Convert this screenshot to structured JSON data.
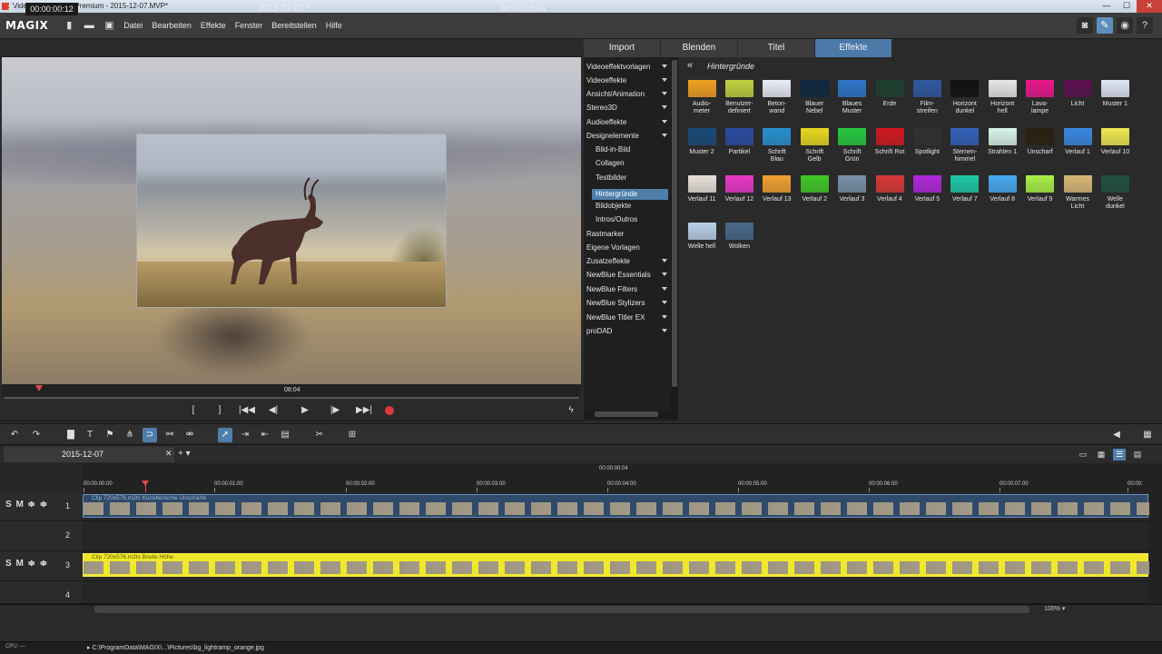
{
  "window": {
    "title": "Video deluxe 2016 Premium - 2015-12-07.MVP*",
    "controls": [
      "—",
      "☐",
      "✕"
    ]
  },
  "menubar": {
    "logo": "MAGIX",
    "items": [
      "Datei",
      "Bearbeiten",
      "Effekte",
      "Fenster",
      "Bereitstellen",
      "Hilfe"
    ]
  },
  "preview": {
    "timecode_left": "00:00:00:12",
    "project_title": "2015-12-07 *",
    "timecode_right": "00:00:08:04",
    "scrub_time": "08:04",
    "transport": [
      "[",
      "]",
      "|◀◀",
      "◀|",
      "▶",
      "|▶",
      "▶▶|"
    ]
  },
  "tabs": [
    {
      "label": "Import",
      "active": false
    },
    {
      "label": "Blenden",
      "active": false
    },
    {
      "label": "Titel",
      "active": false
    },
    {
      "label": "Effekte",
      "active": true
    }
  ],
  "categories": [
    {
      "label": "Videoeffektvorlagen",
      "sub": false,
      "caret": true
    },
    {
      "label": "Videoeffekte",
      "sub": false,
      "caret": true
    },
    {
      "label": "Ansicht/Animation",
      "sub": false,
      "caret": true
    },
    {
      "label": "Stereo3D",
      "sub": false,
      "caret": true
    },
    {
      "label": "Audioeffekte",
      "sub": false,
      "caret": true
    },
    {
      "label": "Designelemente",
      "sub": false,
      "caret": true
    },
    {
      "label": "Bild-in-Bild",
      "sub": true,
      "caret": false
    },
    {
      "label": "Collagen",
      "sub": true,
      "caret": false
    },
    {
      "label": "Testbilder",
      "sub": true,
      "caret": false
    },
    {
      "label": "Hintergründe",
      "sub": true,
      "caret": false,
      "selected": true
    },
    {
      "label": "Bildobjekte",
      "sub": true,
      "caret": false
    },
    {
      "label": "Intros/Outros",
      "sub": true,
      "caret": false
    },
    {
      "label": "Rastmarker",
      "sub": false,
      "caret": false
    },
    {
      "label": "Eigene Vorlagen",
      "sub": false,
      "caret": false
    },
    {
      "label": "Zusatzeffekte",
      "sub": false,
      "caret": true
    },
    {
      "label": "NewBlue Essentials",
      "sub": false,
      "caret": true
    },
    {
      "label": "NewBlue Filters",
      "sub": false,
      "caret": true
    },
    {
      "label": "NewBlue Stylizers",
      "sub": false,
      "caret": true
    },
    {
      "label": "NewBlue Titler EX",
      "sub": false,
      "caret": true
    },
    {
      "label": "proDAD",
      "sub": false,
      "caret": true
    }
  ],
  "grid": {
    "back_icon": "«",
    "title": "Hintergründe",
    "items": [
      {
        "label": "Audio-\nmeter",
        "color": "#f0a020"
      },
      {
        "label": "Benutzer-\ndefiniert",
        "color": "#c0d040"
      },
      {
        "label": "Beton-\nwand",
        "color": "#e8ecf4"
      },
      {
        "label": "Blauer\nNebel",
        "color": "#0f2840"
      },
      {
        "label": "Blaues\nMuster",
        "color": "#2e74c8"
      },
      {
        "label": "Erde",
        "color": "#1e4030"
      },
      {
        "label": "Film-\nstreifen",
        "color": "#3058a0"
      },
      {
        "label": "Horizont\ndunkel",
        "color": "#101010"
      },
      {
        "label": "Horizont\nhell",
        "color": "#e6e6e6"
      },
      {
        "label": "Lava-\nlampe",
        "color": "#e8188c"
      },
      {
        "label": "Licht",
        "color": "#5a1050"
      },
      {
        "label": "Muster 1",
        "color": "#dfe6f4"
      },
      {
        "label": "Muster 2",
        "color": "#1a4a78"
      },
      {
        "label": "Partikel",
        "color": "#2a4aa0"
      },
      {
        "label": "Schrift\nBlau",
        "color": "#2890d0"
      },
      {
        "label": "Schrift\nGelb",
        "color": "#e8d820"
      },
      {
        "label": "Schrift\nGrün",
        "color": "#28c840"
      },
      {
        "label": "Schrift Rot",
        "color": "#d01820"
      },
      {
        "label": "Spotlight",
        "color": "#303030"
      },
      {
        "label": "Sternen-\nhimmel",
        "color": "#3460b8"
      },
      {
        "label": "Strahlen 1",
        "color": "#d8f4e8"
      },
      {
        "label": "Unscharf",
        "color": "#2a2010"
      },
      {
        "label": "Verlauf 1",
        "color": "#3a88e0"
      },
      {
        "label": "Verlauf 10",
        "color": "#f0e850"
      },
      {
        "label": "Verlauf 11",
        "color": "#e8e0d8"
      },
      {
        "label": "Verlauf 12",
        "color": "#e838c8"
      },
      {
        "label": "Verlauf 13",
        "color": "#f0a030"
      },
      {
        "label": "Verlauf 2",
        "color": "#40c828"
      },
      {
        "label": "Verlauf 3",
        "color": "#7890a8"
      },
      {
        "label": "Verlauf 4",
        "color": "#d83838"
      },
      {
        "label": "Verlauf 5",
        "color": "#b028d8"
      },
      {
        "label": "Verlauf 7",
        "color": "#20c8a8"
      },
      {
        "label": "Verlauf 8",
        "color": "#48a8f0"
      },
      {
        "label": "Verlauf 9",
        "color": "#a8f048"
      },
      {
        "label": "Warmes\nLicht",
        "color": "#d8b878"
      },
      {
        "label": "Welle\ndunkel",
        "color": "#205040"
      },
      {
        "label": "Welle hell",
        "color": "#b8d0e8"
      },
      {
        "label": "Wolken",
        "color": "#486888"
      }
    ]
  },
  "timeline": {
    "project_tab": "2015-12-07",
    "close": "✕",
    "add": "+ ▾",
    "center_time": "00:00:00:04",
    "ruler": [
      "00:00:00:00",
      "00:00:01:00",
      "00:00:02:00",
      "00:00:03:00",
      "00:00:04:00",
      "00:00:05:00",
      "00:00:06:00",
      "00:00:07:00",
      "00:00:"
    ],
    "tracks": [
      {
        "num": "1",
        "smb": "S M ≑ ≑",
        "clip": "Clip 720x576.m2ts  Künstlerische Unschärfe",
        "yellow": false
      },
      {
        "num": "2",
        "smb": "",
        "clip": "",
        "yellow": false
      },
      {
        "num": "3",
        "smb": "S M ≑ ≑",
        "clip": "Clip 720x576.m2ts  Breite  Höhe",
        "yellow": true
      },
      {
        "num": "4",
        "smb": "",
        "clip": "",
        "yellow": false
      }
    ],
    "zoom": "100% ▾"
  },
  "status": {
    "cpu": "CPU: —",
    "path": "▸ C:\\ProgramData\\MAGIX\\...\\Pictures\\bg_lightramp_orange.jpg"
  },
  "colors": {
    "accent": "#4e7eaa",
    "record": "#e03838",
    "playhead": "#e04b4b"
  }
}
